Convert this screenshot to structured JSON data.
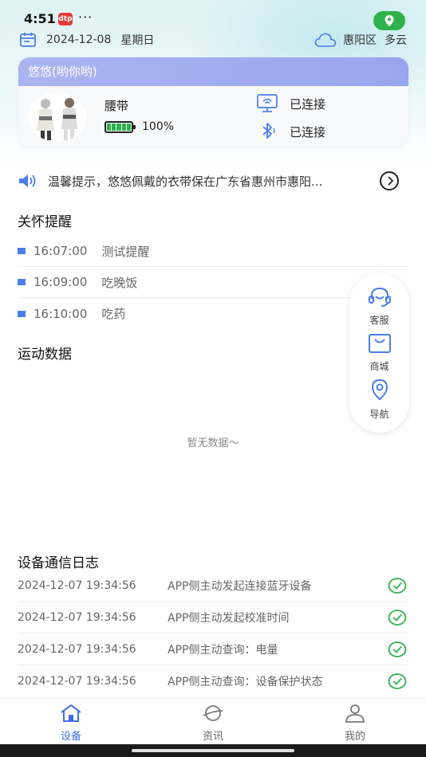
{
  "status_bar": {
    "time": "4:51",
    "app_badge": "dtp",
    "more": "···"
  },
  "header": {
    "date": "2024-12-08",
    "weekday": "星期日",
    "district": "惠阳区",
    "weather": "多云"
  },
  "device_card": {
    "title": "悠悠(哟你哟)",
    "device_name": "腰带",
    "battery_pct": 100,
    "battery_text": "100%",
    "server_status": "已连接",
    "bluetooth_status": "已连接"
  },
  "notice": {
    "text": "温馨提示，悠悠佩戴的衣带保在广东省惠州市惠阳..."
  },
  "care": {
    "title": "关怀提醒",
    "items": [
      {
        "time": "16:07:00",
        "name": "测试提醒"
      },
      {
        "time": "16:09:00",
        "name": "吃晚饭"
      },
      {
        "time": "16:10:00",
        "name": "吃药"
      }
    ]
  },
  "sport": {
    "title": "运动数据",
    "empty": "暂无数据～"
  },
  "float_menu": {
    "service": "客服",
    "mall": "商城",
    "nav": "导航"
  },
  "logs": {
    "title": "设备通信日志",
    "items": [
      {
        "time": "2024-12-07 19:34:56",
        "msg": "APP侧主动发起连接蓝牙设备"
      },
      {
        "time": "2024-12-07 19:34:56",
        "msg": "APP侧主动发起校准时间"
      },
      {
        "time": "2024-12-07 19:34:56",
        "msg": "APP侧主动查询：电量"
      },
      {
        "time": "2024-12-07 19:34:56",
        "msg": "APP侧主动查询：设备保护状态"
      }
    ]
  },
  "tabs": {
    "device": "设备",
    "news": "资讯",
    "mine": "我的"
  },
  "colors": {
    "accent": "#3f6fe0",
    "card_header": "#9fabef",
    "ok_green": "#2fb14b"
  }
}
